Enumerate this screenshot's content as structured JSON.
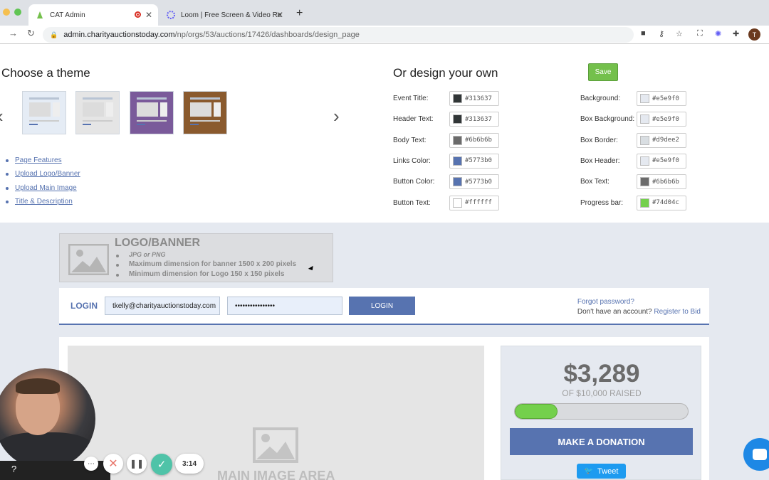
{
  "browser": {
    "tabs": [
      {
        "title": "CAT Admin",
        "active": true
      },
      {
        "title": "Loom | Free Screen & Video Re",
        "active": false
      }
    ],
    "url_host": "admin.charityauctionstoday.com",
    "url_path": "/np/orgs/53/auctions/17426/dashboards/design_page",
    "profile_initial": "T"
  },
  "theme_section": {
    "title": "Choose a theme",
    "themes": [
      {
        "bg": "#e5ecf5"
      },
      {
        "bg": "#e5e5e5"
      },
      {
        "bg": "#7a5a9a"
      },
      {
        "bg": "#8a5a2e"
      }
    ],
    "links": [
      "Page Features",
      "Upload Logo/Banner",
      "Upload Main Image",
      "Title & Description"
    ]
  },
  "design_section": {
    "title": "Or design your own",
    "save_label": "Save",
    "left_colors": [
      {
        "label": "Event Title:",
        "value": "#313637"
      },
      {
        "label": "Header Text:",
        "value": "#313637"
      },
      {
        "label": "Body Text:",
        "value": "#6b6b6b"
      },
      {
        "label": "Links Color:",
        "value": "#5773b0"
      },
      {
        "label": "Button Color:",
        "value": "#5773b0"
      },
      {
        "label": "Button Text:",
        "value": "#ffffff"
      }
    ],
    "right_colors": [
      {
        "label": "Background:",
        "value": "#e5e9f0"
      },
      {
        "label": "Box Background:",
        "value": "#e5e9f0"
      },
      {
        "label": "Box Border:",
        "value": "#d9dee2"
      },
      {
        "label": "Box Header:",
        "value": "#e5e9f0"
      },
      {
        "label": "Box Text:",
        "value": "#6b6b6b"
      },
      {
        "label": "Progress bar:",
        "value": "#74d04c"
      }
    ]
  },
  "preview": {
    "logo_banner": {
      "heading": "LOGO/BANNER",
      "items": [
        "JPG or PNG",
        "Maximum dimension for banner 1500 x 200 pixels",
        "Minimum dimension for Logo 150 x 150 pixels"
      ]
    },
    "login": {
      "label": "LOGIN",
      "email_value": "tkelly@charityauctionstoday.com",
      "password_value": "••••••••••••••••",
      "button_label": "LOGIN",
      "forgot_label": "Forgot password?",
      "no_account_label": "Don't have an account?",
      "register_label": "Register to Bid"
    },
    "main_image_label": "MAIN IMAGE AREA",
    "donation": {
      "amount": "$3,289",
      "raised_text": "OF $10,000 RAISED",
      "progress_fraction": 0.3289,
      "donate_label": "MAKE A DONATION",
      "tweet_label": "Tweet"
    }
  },
  "loom": {
    "timer": "3:14"
  }
}
